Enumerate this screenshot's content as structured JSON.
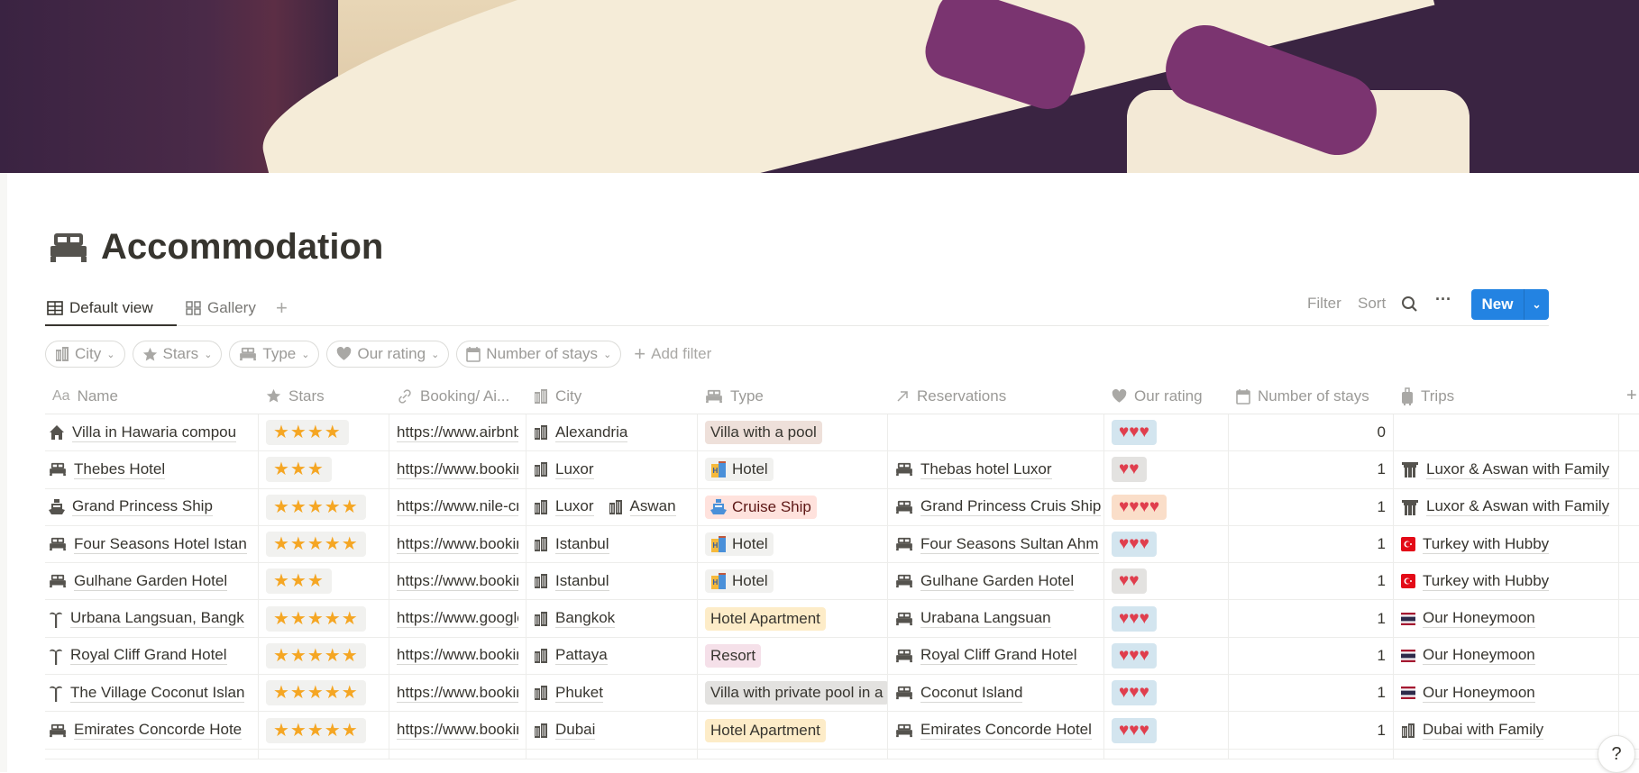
{
  "page": {
    "title": "Accommodation",
    "icon": "bed-icon"
  },
  "views": {
    "tabs": [
      {
        "label": "Default view",
        "icon": "table-icon",
        "active": true
      },
      {
        "label": "Gallery",
        "icon": "gallery-icon",
        "active": false
      }
    ],
    "add": "+"
  },
  "toolbar": {
    "filter": "Filter",
    "sort": "Sort",
    "search_icon": "search-icon",
    "more_icon": "more-icon",
    "new_label": "New",
    "accent": "#2383e2"
  },
  "filters": {
    "chips": [
      {
        "label": "City",
        "icon": "city-icon"
      },
      {
        "label": "Stars",
        "icon": "star-icon"
      },
      {
        "label": "Type",
        "icon": "bed-icon"
      },
      {
        "label": "Our rating",
        "icon": "heart-icon"
      },
      {
        "label": "Number of stays",
        "icon": "calendar-icon"
      }
    ],
    "add_filter": "Add filter"
  },
  "columns": [
    {
      "label": "Name",
      "icon": "text-icon"
    },
    {
      "label": "Stars",
      "icon": "star-icon"
    },
    {
      "label": "Booking/ Ai...",
      "icon": "link-icon"
    },
    {
      "label": "City",
      "icon": "city-icon"
    },
    {
      "label": "Type",
      "icon": "bed-icon"
    },
    {
      "label": "Reservations",
      "icon": "arrow-icon"
    },
    {
      "label": "Our rating",
      "icon": "heart-icon"
    },
    {
      "label": "Number of stays",
      "icon": "calendar-icon"
    },
    {
      "label": "Trips",
      "icon": "luggage-icon"
    }
  ],
  "type_colors": {
    "Villa with a pool": "#eee0da",
    "Hotel": "#f1f1ef",
    "Cruise Ship": "#ffe2dd",
    "Hotel Apartment": "#fdecc8",
    "Resort": "#f5e0e9",
    "Villa with private pool in a": "#e3e2e0"
  },
  "rating_colors": {
    "2": "#e3e2e0",
    "3": "#d3e5ef",
    "4": "#fadec9"
  },
  "rows": [
    {
      "name": "Villa in Hawaria compou",
      "icon": "house-icon",
      "stars": 4,
      "url": "https://www.airbnb",
      "cities": [
        "Alexandria"
      ],
      "type": "Villa with a pool",
      "type_icon": "",
      "reservation": "",
      "rating": 3,
      "stays": "0",
      "trip": "",
      "trip_icon": ""
    },
    {
      "name": "Thebes Hotel",
      "icon": "bed-icon",
      "stars": 3,
      "url": "https://www.booking",
      "cities": [
        "Luxor"
      ],
      "type": "Hotel",
      "type_icon": "hotel-icon",
      "reservation": "Thebas hotel Luxor",
      "rating": 2,
      "stays": "1",
      "trip": "Luxor & Aswan with Family",
      "trip_icon": "temple-icon"
    },
    {
      "name": "Grand Princess Ship",
      "icon": "ship-icon",
      "stars": 5,
      "url": "https://www.nile-cruise",
      "cities": [
        "Luxor",
        "Aswan"
      ],
      "type": "Cruise Ship",
      "type_icon": "ship-icon",
      "reservation": "Grand Princess Cruis Ship",
      "rating": 4,
      "stays": "1",
      "trip": "Luxor & Aswan with Family",
      "trip_icon": "temple-icon"
    },
    {
      "name": "Four Seasons Hotel Istan",
      "icon": "bed-icon",
      "stars": 5,
      "url": "https://www.booking",
      "cities": [
        "Istanbul"
      ],
      "type": "Hotel",
      "type_icon": "hotel-icon",
      "reservation": "Four Seasons Sultan Ahm",
      "rating": 3,
      "stays": "1",
      "trip": "Turkey with Hubby",
      "trip_icon": "turkey-flag-icon"
    },
    {
      "name": "Gulhane Garden Hotel",
      "icon": "bed-icon",
      "stars": 3,
      "url": "https://www.booking",
      "cities": [
        "Istanbul"
      ],
      "type": "Hotel",
      "type_icon": "hotel-icon",
      "reservation": "Gulhane Garden Hotel",
      "rating": 2,
      "stays": "1",
      "trip": "Turkey with Hubby",
      "trip_icon": "turkey-flag-icon"
    },
    {
      "name": "Urbana Langsuan, Bangk",
      "icon": "palm-icon",
      "stars": 5,
      "url": "https://www.google",
      "cities": [
        "Bangkok"
      ],
      "type": "Hotel Apartment",
      "type_icon": "",
      "reservation": "Urabana Langsuan",
      "rating": 3,
      "stays": "1",
      "trip": "Our Honeymoon",
      "trip_icon": "thailand-flag-icon"
    },
    {
      "name": "Royal Cliff Grand Hotel",
      "icon": "palm-icon",
      "stars": 5,
      "url": "https://www.booking",
      "cities": [
        "Pattaya"
      ],
      "type": "Resort",
      "type_icon": "",
      "reservation": "Royal Cliff Grand Hotel",
      "rating": 3,
      "stays": "1",
      "trip": "Our Honeymoon",
      "trip_icon": "thailand-flag-icon"
    },
    {
      "name": "The Village Coconut Islan",
      "icon": "palm-icon",
      "stars": 5,
      "url": "https://www.booking",
      "cities": [
        "Phuket"
      ],
      "type": "Villa with private pool in a",
      "type_icon": "",
      "reservation": "Coconut Island",
      "rating": 3,
      "stays": "1",
      "trip": "Our Honeymoon",
      "trip_icon": "thailand-flag-icon"
    },
    {
      "name": "Emirates Concorde Hote",
      "icon": "bed-icon",
      "stars": 5,
      "url": "https://www.booking",
      "cities": [
        "Dubai"
      ],
      "type": "Hotel Apartment",
      "type_icon": "",
      "reservation": "Emirates Concorde Hotel",
      "rating": 3,
      "stays": "1",
      "trip": "Dubai with Family",
      "trip_icon": "city-icon"
    }
  ],
  "help": "?"
}
